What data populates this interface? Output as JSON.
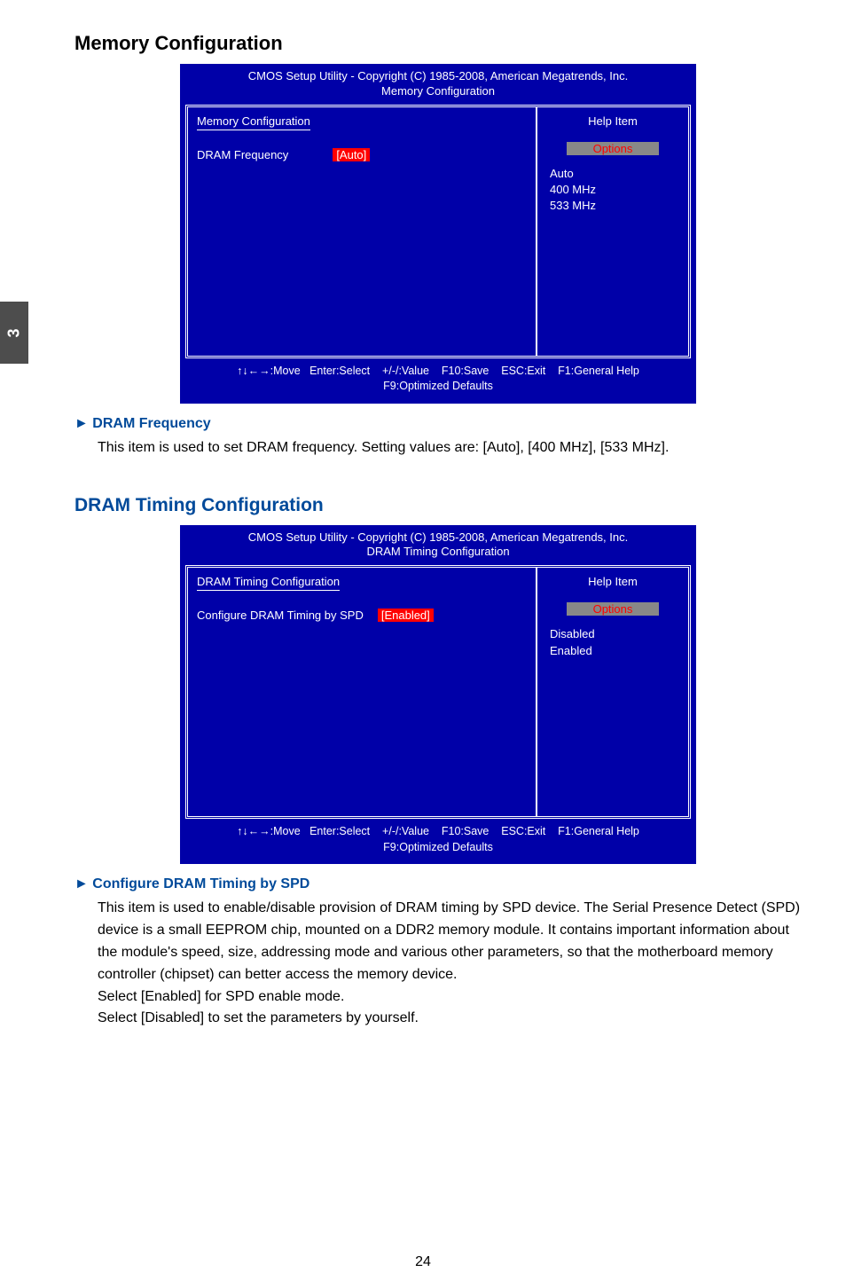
{
  "sidetab": "3",
  "section1": {
    "title": "Memory Configuration",
    "bios": {
      "header_line1": "CMOS Setup Utility - Copyright (C) 1985-2008, American Megatrends, Inc.",
      "header_line2": "Memory Configuration",
      "left_title": "Memory Configuration",
      "row_label": "DRAM Frequency",
      "row_value": "[Auto]",
      "help_label": "Help Item",
      "options_label": "Options",
      "options": [
        "Auto",
        "400 MHz",
        "533 MHz"
      ],
      "footer_line1": "↑↓←→:Move   Enter:Select    +/-/:Value    F10:Save    ESC:Exit    F1:General Help",
      "footer_line2": "F9:Optimized Defaults"
    },
    "item": {
      "heading": "► DRAM Frequency",
      "body": "This item is used to set DRAM frequency. Setting values are: [Auto], [400 MHz], [533 MHz]."
    }
  },
  "section2": {
    "title": "DRAM Timing Configuration",
    "bios": {
      "header_line1": "CMOS Setup Utility - Copyright (C) 1985-2008, American Megatrends, Inc.",
      "header_line2": "DRAM Timing Configuration",
      "left_title": "DRAM Timing Configuration",
      "row_label": "Configure DRAM Timing by SPD",
      "row_value": "[Enabled]",
      "help_label": "Help Item",
      "options_label": "Options",
      "options": [
        "Disabled",
        "Enabled"
      ],
      "footer_line1": "↑↓←→:Move   Enter:Select    +/-/:Value    F10:Save    ESC:Exit    F1:General Help",
      "footer_line2": "F9:Optimized Defaults"
    },
    "item": {
      "heading": "► Configure DRAM Timing by SPD",
      "body1": "This item is used to enable/disable provision of DRAM timing by SPD device. The Serial Presence Detect (SPD) device is a small EEPROM chip, mounted on a DDR2 memory module. It contains important information about the module's speed, size, addressing mode and various other parameters, so that the motherboard memory controller (chipset) can better access the memory device.",
      "body2": "Select [Enabled] for SPD enable mode.",
      "body3": "Select [Disabled] to set the parameters by yourself."
    }
  },
  "page_number": "24"
}
